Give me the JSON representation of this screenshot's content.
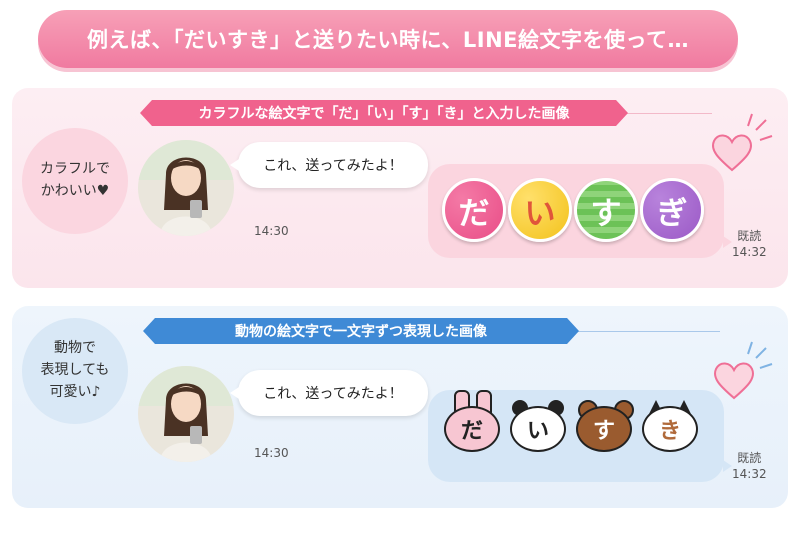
{
  "banner": {
    "title": "例えば、「だいすき」と送りたい時に、LINE絵文字を使って…"
  },
  "section1": {
    "ribbon": "カラフルな絵文字で「だ」「い」「す」「き」と入力した画像",
    "circle": [
      "カラフルで",
      "かわいい♥"
    ],
    "message": "これ、送ってみたよ！",
    "time_left": "14:30",
    "read_label": "既読",
    "time_right": "14:32",
    "stickers": [
      {
        "char": "だ",
        "color": "#e94d87"
      },
      {
        "char": "い",
        "color": "#f3c21b"
      },
      {
        "char": "す",
        "color": "#5bb64a"
      },
      {
        "char": "ぎ",
        "color": "#9b59c6"
      }
    ]
  },
  "section2": {
    "ribbon": "動物の絵文字で一文字ずつ表現した画像",
    "circle": [
      "動物で",
      "表現しても",
      "可愛い♪"
    ],
    "message": "これ、送ってみたよ！",
    "time_left": "14:30",
    "read_label": "既読",
    "time_right": "14:32",
    "animals": [
      {
        "char": "だ",
        "animal": "rabbit",
        "color": "#f7c6d2"
      },
      {
        "char": "い",
        "animal": "panda",
        "color": "#ffffff"
      },
      {
        "char": "す",
        "animal": "bear",
        "color": "#9a5b2f"
      },
      {
        "char": "き",
        "animal": "cat",
        "color": "#ffffff"
      }
    ]
  },
  "colors": {
    "pink_accent": "#f0628d",
    "blue_accent": "#3f8ad6"
  }
}
